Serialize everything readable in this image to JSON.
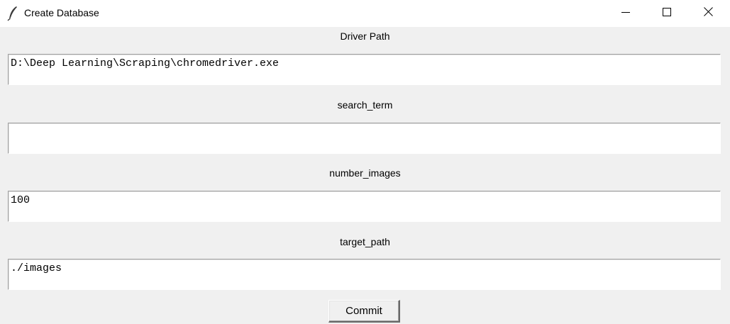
{
  "window": {
    "title": "Create Database",
    "icon": "feather-icon",
    "controls": [
      "minimize-icon",
      "maximize-icon",
      "close-icon"
    ]
  },
  "fields": [
    {
      "label": "Driver Path",
      "value": "D:\\Deep Learning\\Scraping\\chromedriver.exe"
    },
    {
      "label": "search_term",
      "value": ""
    },
    {
      "label": "number_images",
      "value": "100"
    },
    {
      "label": "target_path",
      "value": "./images"
    }
  ],
  "commit_label": "Commit"
}
